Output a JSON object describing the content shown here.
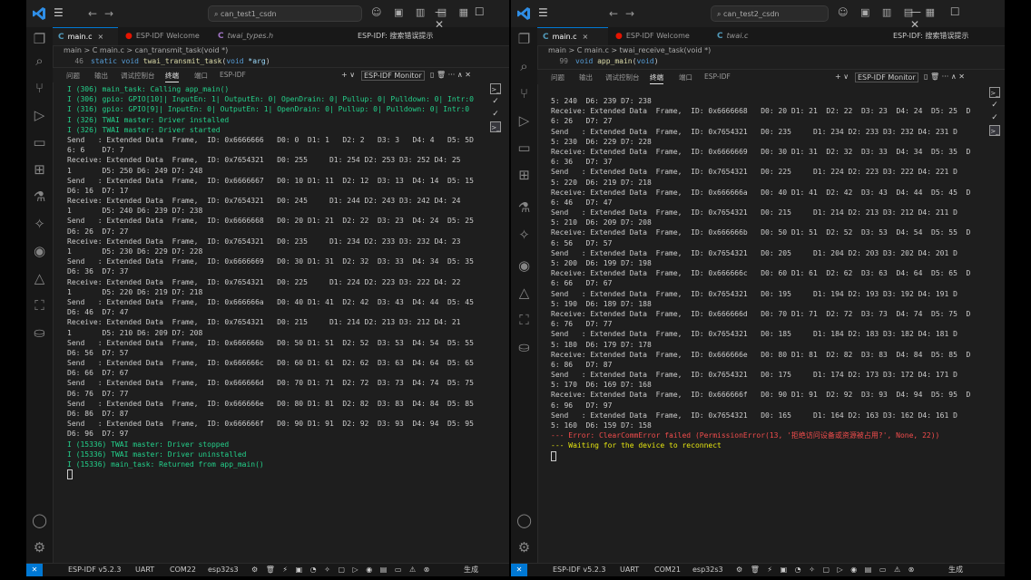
{
  "colors": {
    "accent": "#0078d4",
    "green": "#23d18b",
    "red": "#f14c4c",
    "yellow": "#e5e510"
  },
  "common": {
    "menu_icon": "☰",
    "nav_back": "←",
    "nav_fwd": "→",
    "search_icon": "⌕",
    "tool_icons": "☺ ▣ ▥ ▤ ▦",
    "win_controls": "— ☐ ✕",
    "crumb_sep": ">",
    "panel_tabs": [
      "问题",
      "输出",
      "调试控制台",
      "终端",
      "端口",
      "ESP-IDF"
    ],
    "panel_add": "+ ∨",
    "panel_monitor": "ESP-IDF Monitor",
    "panel_tools": "▯ 🗑 ··· ∧ ✕",
    "esp_idf_label": "ESP-IDF:",
    "search_error_label": "搜索错误提示",
    "tab_close": "×",
    "status": {
      "remote": "✕",
      "idf": "ESP-IDF v5.2.3",
      "uart": "UART",
      "port_w1": "COM22",
      "port_w2": "COM21",
      "target": "esp32s3",
      "build": "生成",
      "icons": "⚙ 🗑 ⚡ ▣ ◔ ✧ ▢ ▷ ◉ ▤ ▭ ⚠ ⊗"
    }
  },
  "window1": {
    "title": "can_test1_csdn",
    "tabs": [
      {
        "icon": "C",
        "label": "main.c",
        "active": true
      },
      {
        "icon": "●",
        "label": "ESP-IDF Welcome",
        "active": false
      },
      {
        "icon": "C",
        "label": "twai_types.h",
        "active": false
      }
    ],
    "breadcrumb": [
      "main",
      "C main.c",
      "can_transmit_task(void *)"
    ],
    "code_line_no": "46",
    "code": {
      "kw": "static void ",
      "fn": "twai_transmit_task",
      "pre": "(",
      "kw2": "void ",
      "pr": "*arg",
      "post": ")"
    },
    "terminal_lines": [
      {
        "c": "g",
        "t": "I (306) main_task: Calling app_main()"
      },
      {
        "c": "g",
        "t": "I (306) gpio: GPIO[10]| InputEn: 1| OutputEn: 0| OpenDrain: 0| Pullup: 0| Pulldown: 0| Intr:0"
      },
      {
        "c": "g",
        "t": "I (316) gpio: GPIO[9]| InputEn: 0| OutputEn: 1| OpenDrain: 0| Pullup: 0| Pulldown: 0| Intr:0"
      },
      {
        "c": "g",
        "t": "I (326) TWAI master: Driver installed"
      },
      {
        "c": "g",
        "t": "I (326) TWAI master: Driver started"
      },
      {
        "c": "w",
        "t": "Send   : Extended Data  Frame,  ID: 0x6666666   D0: 0  D1: 1   D2: 2   D3: 3   D4: 4   D5: 5D"
      },
      {
        "c": "w",
        "t": "6: 6    D7: 7"
      },
      {
        "c": "w",
        "t": "Receive: Extended Data  Frame,  ID: 0x7654321   D0: 255     D1: 254 D2: 253 D3: 252 D4: 25"
      },
      {
        "c": "w",
        "t": "1       D5: 250 D6: 249 D7: 248"
      },
      {
        "c": "w",
        "t": "Send   : Extended Data  Frame,  ID: 0x6666667   D0: 10 D1: 11  D2: 12  D3: 13  D4: 14  D5: 15"
      },
      {
        "c": "w",
        "t": "D6: 16  D7: 17"
      },
      {
        "c": "w",
        "t": "Receive: Extended Data  Frame,  ID: 0x7654321   D0: 245     D1: 244 D2: 243 D3: 242 D4: 24"
      },
      {
        "c": "w",
        "t": "1       D5: 240 D6: 239 D7: 238"
      },
      {
        "c": "w",
        "t": "Send   : Extended Data  Frame,  ID: 0x6666668   D0: 20 D1: 21  D2: 22  D3: 23  D4: 24  D5: 25"
      },
      {
        "c": "w",
        "t": "D6: 26  D7: 27"
      },
      {
        "c": "w",
        "t": "Receive: Extended Data  Frame,  ID: 0x7654321   D0: 235     D1: 234 D2: 233 D3: 232 D4: 23"
      },
      {
        "c": "w",
        "t": "1       D5: 230 D6: 229 D7: 228"
      },
      {
        "c": "w",
        "t": "Send   : Extended Data  Frame,  ID: 0x6666669   D0: 30 D1: 31  D2: 32  D3: 33  D4: 34  D5: 35"
      },
      {
        "c": "w",
        "t": "D6: 36  D7: 37"
      },
      {
        "c": "w",
        "t": "Receive: Extended Data  Frame,  ID: 0x7654321   D0: 225     D1: 224 D2: 223 D3: 222 D4: 22"
      },
      {
        "c": "w",
        "t": "1       D5: 220 D6: 219 D7: 218"
      },
      {
        "c": "w",
        "t": "Send   : Extended Data  Frame,  ID: 0x666666a   D0: 40 D1: 41  D2: 42  D3: 43  D4: 44  D5: 45"
      },
      {
        "c": "w",
        "t": "D6: 46  D7: 47"
      },
      {
        "c": "w",
        "t": "Receive: Extended Data  Frame,  ID: 0x7654321   D0: 215     D1: 214 D2: 213 D3: 212 D4: 21"
      },
      {
        "c": "w",
        "t": "1       D5: 210 D6: 209 D7: 208"
      },
      {
        "c": "w",
        "t": "Send   : Extended Data  Frame,  ID: 0x666666b   D0: 50 D1: 51  D2: 52  D3: 53  D4: 54  D5: 55"
      },
      {
        "c": "w",
        "t": "D6: 56  D7: 57"
      },
      {
        "c": "w",
        "t": "Send   : Extended Data  Frame,  ID: 0x666666c   D0: 60 D1: 61  D2: 62  D3: 63  D4: 64  D5: 65"
      },
      {
        "c": "w",
        "t": "D6: 66  D7: 67"
      },
      {
        "c": "w",
        "t": "Send   : Extended Data  Frame,  ID: 0x666666d   D0: 70 D1: 71  D2: 72  D3: 73  D4: 74  D5: 75"
      },
      {
        "c": "w",
        "t": "D6: 76  D7: 77"
      },
      {
        "c": "w",
        "t": "Send   : Extended Data  Frame,  ID: 0x666666e   D0: 80 D1: 81  D2: 82  D3: 83  D4: 84  D5: 85"
      },
      {
        "c": "w",
        "t": "D6: 86  D7: 87"
      },
      {
        "c": "w",
        "t": "Send   : Extended Data  Frame,  ID: 0x666666f   D0: 90 D1: 91  D2: 92  D3: 93  D4: 94  D5: 95"
      },
      {
        "c": "w",
        "t": "D6: 96  D7: 97"
      },
      {
        "c": "g",
        "t": "I (15336) TWAI master: Driver stopped"
      },
      {
        "c": "g",
        "t": "I (15336) TWAI master: Driver uninstalled"
      },
      {
        "c": "g",
        "t": "I (15336) main_task: Returned from app_main()"
      }
    ]
  },
  "window2": {
    "title": "can_test2_csdn",
    "tabs": [
      {
        "icon": "C",
        "label": "main.c",
        "active": true
      },
      {
        "icon": "●",
        "label": "ESP-IDF Welcome",
        "active": false
      },
      {
        "icon": "C",
        "label": "twai.c",
        "active": false
      }
    ],
    "breadcrumb": [
      "main",
      "C main.c",
      "twai_receive_task(void *)"
    ],
    "code_line_no": "99",
    "code": {
      "kw": "void ",
      "fn": "app_main",
      "pre": "(",
      "kw2": "void",
      "pr": "",
      "post": ")"
    },
    "terminal_lines": [
      {
        "c": "w",
        "t": "5: 240  D6: 239 D7: 238"
      },
      {
        "c": "w",
        "t": "Receive: Extended Data  Frame,  ID: 0x6666668   D0: 20 D1: 21  D2: 22  D3: 23  D4: 24  D5: 25  D"
      },
      {
        "c": "w",
        "t": "6: 26   D7: 27"
      },
      {
        "c": "w",
        "t": "Send   : Extended Data  Frame,  ID: 0x7654321   D0: 235     D1: 234 D2: 233 D3: 232 D4: 231 D"
      },
      {
        "c": "w",
        "t": "5: 230  D6: 229 D7: 228"
      },
      {
        "c": "w",
        "t": "Receive: Extended Data  Frame,  ID: 0x6666669   D0: 30 D1: 31  D2: 32  D3: 33  D4: 34  D5: 35  D"
      },
      {
        "c": "w",
        "t": "6: 36   D7: 37"
      },
      {
        "c": "w",
        "t": "Send   : Extended Data  Frame,  ID: 0x7654321   D0: 225     D1: 224 D2: 223 D3: 222 D4: 221 D"
      },
      {
        "c": "w",
        "t": "5: 220  D6: 219 D7: 218"
      },
      {
        "c": "w",
        "t": "Receive: Extended Data  Frame,  ID: 0x666666a   D0: 40 D1: 41  D2: 42  D3: 43  D4: 44  D5: 45  D"
      },
      {
        "c": "w",
        "t": "6: 46   D7: 47"
      },
      {
        "c": "w",
        "t": "Send   : Extended Data  Frame,  ID: 0x7654321   D0: 215     D1: 214 D2: 213 D3: 212 D4: 211 D"
      },
      {
        "c": "w",
        "t": "5: 210  D6: 209 D7: 208"
      },
      {
        "c": "w",
        "t": "Receive: Extended Data  Frame,  ID: 0x666666b   D0: 50 D1: 51  D2: 52  D3: 53  D4: 54  D5: 55  D"
      },
      {
        "c": "w",
        "t": "6: 56   D7: 57"
      },
      {
        "c": "w",
        "t": "Send   : Extended Data  Frame,  ID: 0x7654321   D0: 205     D1: 204 D2: 203 D3: 202 D4: 201 D"
      },
      {
        "c": "w",
        "t": "5: 200  D6: 199 D7: 198"
      },
      {
        "c": "w",
        "t": "Receive: Extended Data  Frame,  ID: 0x666666c   D0: 60 D1: 61  D2: 62  D3: 63  D4: 64  D5: 65  D"
      },
      {
        "c": "w",
        "t": "6: 66   D7: 67"
      },
      {
        "c": "w",
        "t": "Send   : Extended Data  Frame,  ID: 0x7654321   D0: 195     D1: 194 D2: 193 D3: 192 D4: 191 D"
      },
      {
        "c": "w",
        "t": "5: 190  D6: 189 D7: 188"
      },
      {
        "c": "w",
        "t": "Receive: Extended Data  Frame,  ID: 0x666666d   D0: 70 D1: 71  D2: 72  D3: 73  D4: 74  D5: 75  D"
      },
      {
        "c": "w",
        "t": "6: 76   D7: 77"
      },
      {
        "c": "w",
        "t": "Send   : Extended Data  Frame,  ID: 0x7654321   D0: 185     D1: 184 D2: 183 D3: 182 D4: 181 D"
      },
      {
        "c": "w",
        "t": "5: 180  D6: 179 D7: 178"
      },
      {
        "c": "w",
        "t": "Receive: Extended Data  Frame,  ID: 0x666666e   D0: 80 D1: 81  D2: 82  D3: 83  D4: 84  D5: 85  D"
      },
      {
        "c": "w",
        "t": "6: 86   D7: 87"
      },
      {
        "c": "w",
        "t": "Send   : Extended Data  Frame,  ID: 0x7654321   D0: 175     D1: 174 D2: 173 D3: 172 D4: 171 D"
      },
      {
        "c": "w",
        "t": "5: 170  D6: 169 D7: 168"
      },
      {
        "c": "w",
        "t": "Receive: Extended Data  Frame,  ID: 0x666666f   D0: 90 D1: 91  D2: 92  D3: 93  D4: 94  D5: 95  D"
      },
      {
        "c": "w",
        "t": "6: 96   D7: 97"
      },
      {
        "c": "w",
        "t": "Send   : Extended Data  Frame,  ID: 0x7654321   D0: 165     D1: 164 D2: 163 D3: 162 D4: 161 D"
      },
      {
        "c": "w",
        "t": "5: 160  D6: 159 D7: 158"
      },
      {
        "c": "r",
        "t": "--- Error: ClearCommError failed (PermissionError(13, '拒绝访问设备或资源被占用?', None, 22))"
      },
      {
        "c": "y",
        "t": "--- Waiting for the device to reconnect"
      }
    ]
  }
}
